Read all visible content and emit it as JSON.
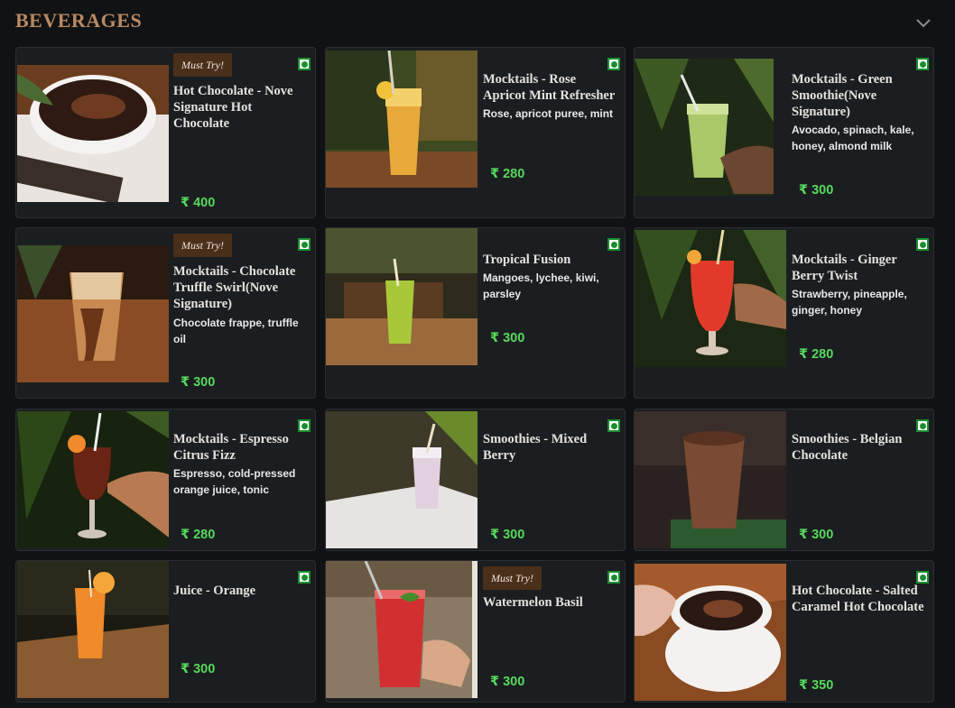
{
  "section": {
    "title": "BEVERAGES"
  },
  "currency": "₹",
  "items": [
    {
      "badge": "Must Try!",
      "name": "Hot Chocolate - Nove Signature Hot Chocolate",
      "desc": "",
      "price": "₹ 400"
    },
    {
      "badge": "",
      "name": "Mocktails - Rose Apricot Mint Refresher",
      "desc": "Rose, apricot puree, mint",
      "price": "₹ 280"
    },
    {
      "badge": "",
      "name": "Mocktails - Green Smoothie(Nove Signature)",
      "desc": "Avocado, spinach, kale, honey, almond milk",
      "price": "₹ 300"
    },
    {
      "badge": "Must Try!",
      "name": "Mocktails - Chocolate Truffle Swirl(Nove Signature)",
      "desc": "Chocolate frappe, truffle oil",
      "price": "₹ 300"
    },
    {
      "badge": "",
      "name": "Tropical Fusion",
      "desc": "Mangoes, lychee, kiwi, parsley",
      "price": "₹ 300"
    },
    {
      "badge": "",
      "name": "Mocktails - Ginger Berry Twist",
      "desc": "Strawberry, pineapple, ginger, honey",
      "price": "₹ 280"
    },
    {
      "badge": "",
      "name": "Mocktails - Espresso Citrus Fizz",
      "desc": "Espresso, cold-pressed orange juice, tonic",
      "price": "₹ 280"
    },
    {
      "badge": "",
      "name": "Smoothies - Mixed Berry",
      "desc": "",
      "price": "₹ 300"
    },
    {
      "badge": "",
      "name": "Smoothies - Belgian Chocolate",
      "desc": "",
      "price": "₹ 300"
    },
    {
      "badge": "",
      "name": "Juice - Orange",
      "desc": "",
      "price": "₹ 300"
    },
    {
      "badge": "Must Try!",
      "name": "Watermelon Basil",
      "desc": "",
      "price": "₹ 300"
    },
    {
      "badge": "",
      "name": "Hot Chocolate - Salted Caramel Hot Chocolate",
      "desc": "",
      "price": "₹ 350"
    }
  ]
}
